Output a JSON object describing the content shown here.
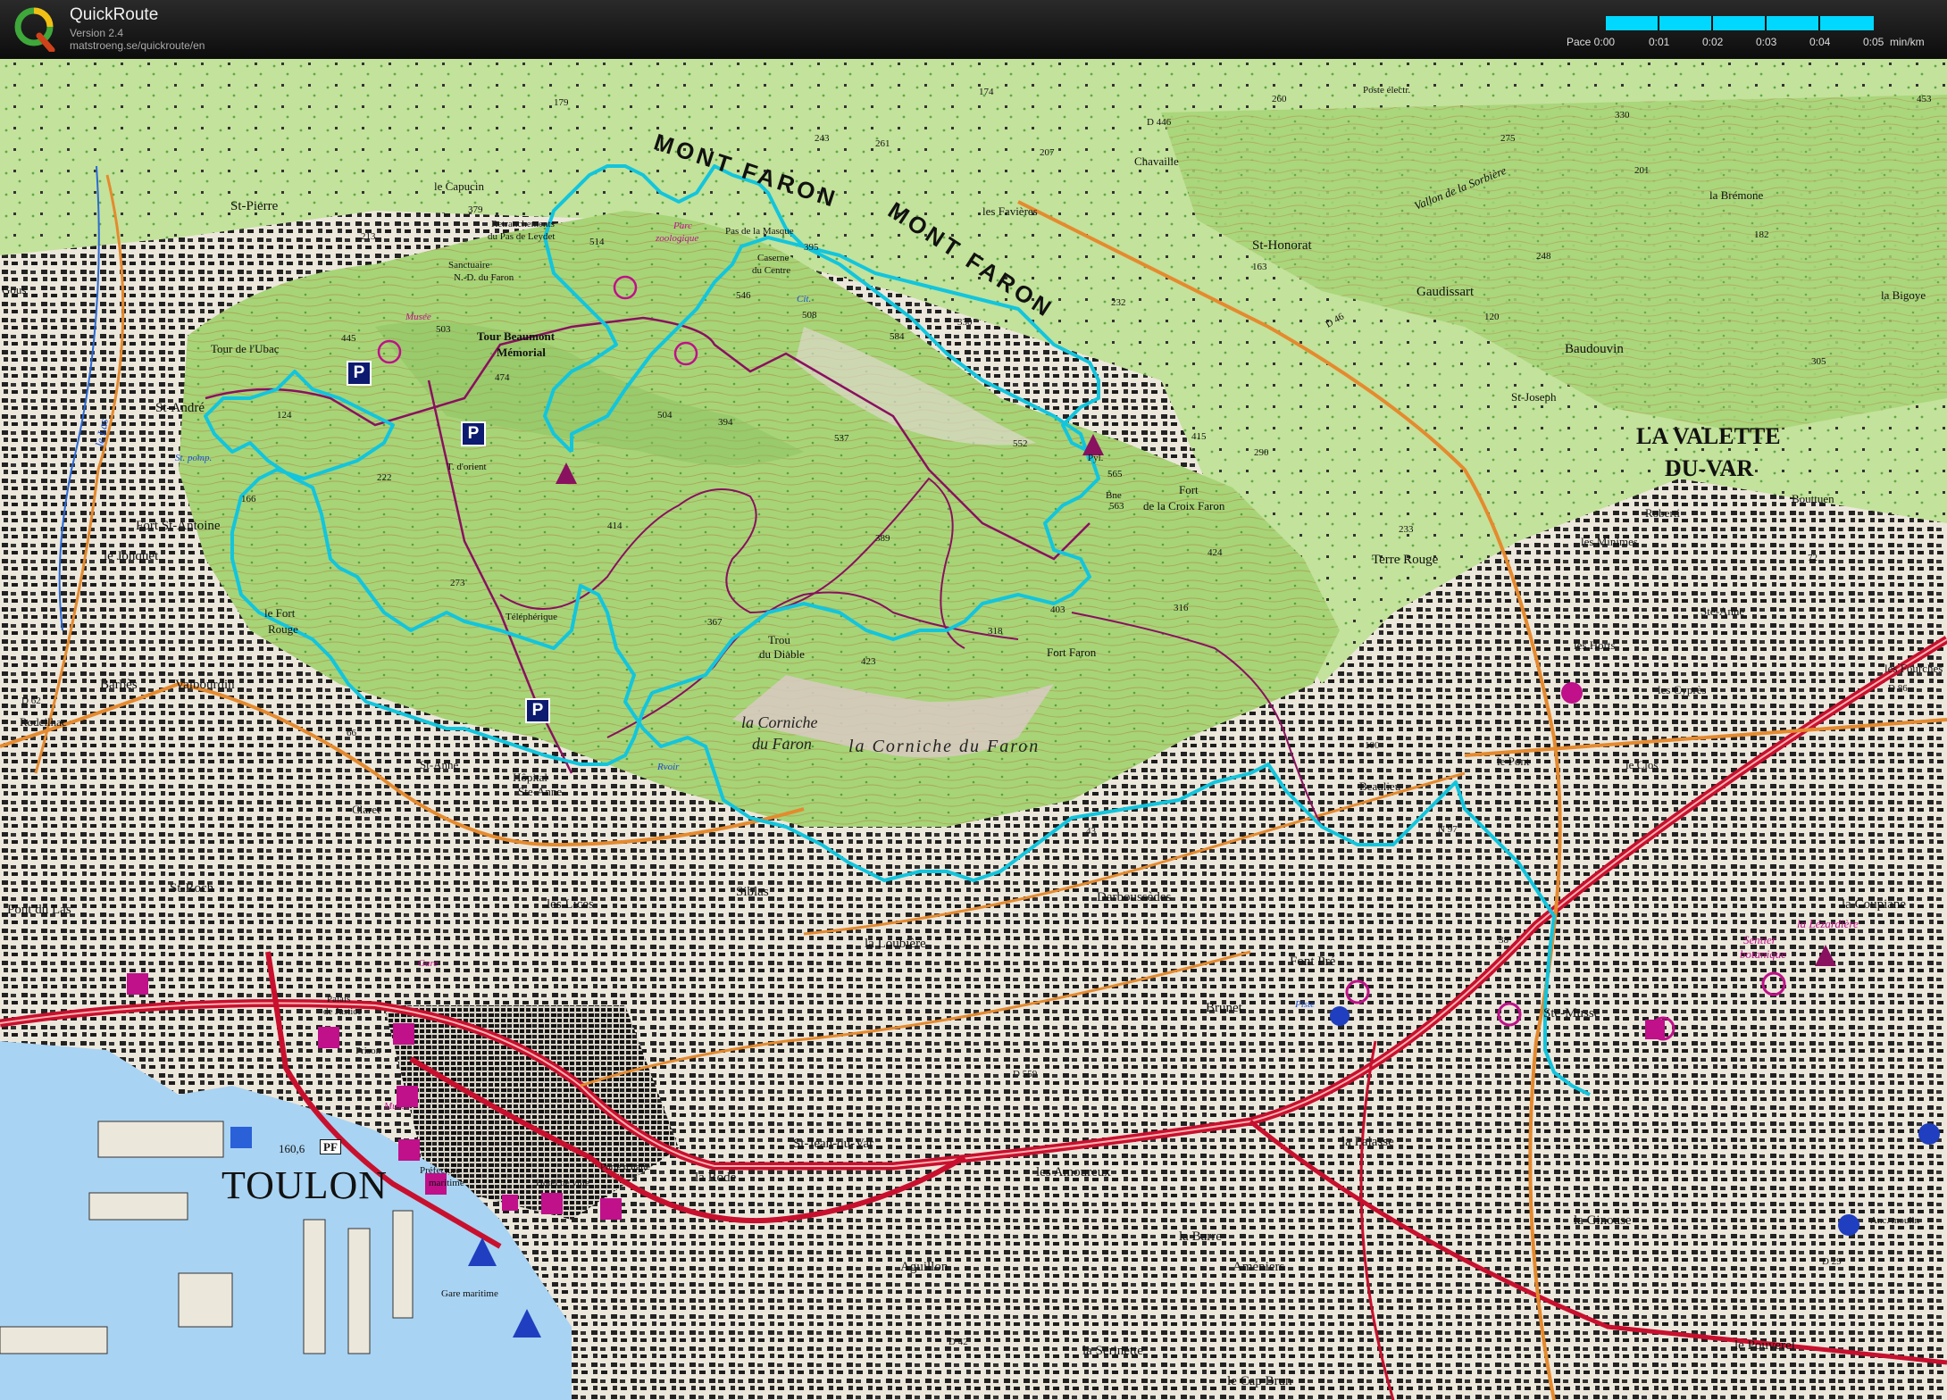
{
  "app": {
    "title": "QuickRoute",
    "version": "Version 2.4",
    "url": "matstroeng.se/quickroute/en"
  },
  "pace_scale": {
    "prefix": "Pace 0:00",
    "ticks": [
      "0:01",
      "0:02",
      "0:03",
      "0:04",
      "0:05"
    ],
    "unit": "min/km",
    "color": "#00d8ff"
  },
  "colors": {
    "route": "#12c5dd",
    "forest": "#9fd070",
    "trail": "#8a1060",
    "sea": "#a9d3f2",
    "urban": "#e7e1d5",
    "main_road": "#c8102e"
  },
  "map_labels": {
    "mont_faron_1": "MONT FARON",
    "mont_faron_2": "MONT FARON",
    "toulon": "TOULON",
    "la_valette": "LA VALETTE",
    "du_var": "DU-VAR",
    "corniche_1": "la Corniche",
    "corniche_2": "du Faron",
    "corniche_3": "la Corniche du Faron",
    "le_capucin": "le Capucin",
    "retranchements": "Retranchements",
    "pas_de_leydet": "du Pas de Leydet",
    "sanctuaire": "Sanctuaire",
    "nd_du_faron": "N.-D. du Faron",
    "parc": "Parc",
    "zoologique": "zoologique",
    "pas_de_la_masque": "Pas de la Masque",
    "caserne": "Caserne",
    "du_centre": "du Centre",
    "tour_beaumont": "Tour Beaumont",
    "memorial": "Mémorial",
    "tour_ubac": "Tour de l'Ubac",
    "musee_faron": "Musée",
    "st_pierre": "St-Pierre",
    "st_andre": "St-André",
    "fort_st_antoine": "Fort St-Antoine",
    "le_jonquet": "le Jonquet",
    "le_fort_rouge_1": "le Fort",
    "le_fort_rouge_2": "Rouge",
    "barbes": "Barbès",
    "valbourdin": "Valbourdin",
    "rodeilhac": "Rodeilhac",
    "claret": "Claret",
    "st_anne": "St-Anne",
    "hopital": "Hôpital",
    "ste_anne_h": "Ste-Anne",
    "st_roch": "St-Roch",
    "pont_du_las": "Pont du Las",
    "les_lices": "les Lices",
    "siblas": "Siblas",
    "la_loubiere": "la Loubière",
    "darboussedes": "Darboussèdes",
    "brunet": "Brunet",
    "font_pre": "Font Pré",
    "st_jean_du_var": "St-Jean-du-Var",
    "la_rode": "la Rode",
    "aguillon": "Aguillon",
    "les_amoureux": "les Amoureux",
    "la_barre": "la Barre",
    "ameniers": "Améniers",
    "la_serinette": "la Serinette",
    "le_cap_brun": "le Cap Brun",
    "la_palasse": "la Palasse",
    "la_ginouse": "la Ginouse",
    "le_pouverel": "le Pouverel",
    "ste_musse": "Ste-Musse",
    "la_coupiane": "la Coupiane",
    "la_lezardiere": "la Lézardière",
    "sentier_botanique_1": "Sentier",
    "sentier_botanique_2": "botanique",
    "beaulieu": "Beaulieu",
    "le_pont": "le Pont",
    "les_cypres": "les Cyprès",
    "les_horts": "les Horts",
    "ste_anne_v": "Ste-Anne",
    "les_minimes": "les Minimes",
    "roberti": "Roberti",
    "terre_rouge": "Terre Rouge",
    "fort_croix_faron_1": "Fort",
    "fort_croix_faron_2": "de la Croix Faron",
    "fort_faron": "Fort Faron",
    "trou_du_diable_1": "Trou",
    "trou_du_diable_2": "du Diable",
    "telepherique": "Téléphérique",
    "les_favieres": "les Favières",
    "chavaille": "Chavaille",
    "st_honorat": "St-Honorat",
    "gaudissart": "Gaudissart",
    "st_joseph": "St-Joseph",
    "baudouvin": "Baudouvin",
    "la_bremone": "la Brémone",
    "la_bigoye": "la Bigoye",
    "vallon_sorbiere": "Vallon de la Sorbière",
    "les_fourches": "les Fourches",
    "le_clos": "le Clos",
    "poste_electr": "Poste électr.",
    "gare_maritime": "Gare maritime",
    "prefecture_1": "Préfecture",
    "prefecture_2": "maritime",
    "hotel_de_ville": "Hôtel de ville",
    "porte_italie": "Porte d'Italie",
    "palais_1": "Palais",
    "palais_2": "de Justice",
    "prison": "Prison",
    "gare": "Gare",
    "musee_toulon": "Musée",
    "pf": "PF",
    "depth_160": "160,6",
    "le_las": "le Las",
    "gous": "Gous",
    "d62": "D 62",
    "d46": "D 46",
    "d446": "D 446",
    "d86": "D 86",
    "d29": "D 29",
    "n97": "N 97",
    "d559": "D 559",
    "d42": "D 42",
    "bouttuen": "Bouttuen",
    "t_dorient": "T. d'orient",
    "pyl": "Pyl.",
    "bne": "Bne",
    "cit": "Cit.",
    "st_pomp": "St. pomp.",
    "rvoir": "Rvoir",
    "piste": "Piste",
    "anc_moulin": "Anc. moulin",
    "alt_179": "179",
    "alt_243": "243",
    "alt_261": "261",
    "alt_174": "174",
    "alt_207": "207",
    "alt_260": "260",
    "alt_275": "275",
    "alt_330": "330",
    "alt_201": "201",
    "alt_248": "248",
    "alt_182": "182",
    "alt_379": "379",
    "alt_213": "213",
    "alt_514": "514",
    "alt_395": "395",
    "alt_546": "546",
    "alt_508": "508",
    "alt_503": "503",
    "alt_445": "445",
    "alt_474": "474",
    "alt_584": "584",
    "alt_330b": "330",
    "alt_232": "232",
    "alt_504": "504",
    "alt_394": "394",
    "alt_537": "537",
    "alt_552": "552",
    "alt_565": "565",
    "alt_563": "563",
    "alt_415": "415",
    "alt_290": "290",
    "alt_424": "424",
    "alt_233": "233",
    "alt_316": "316",
    "alt_403": "403",
    "alt_318": "318",
    "alt_389": "389",
    "alt_414": "414",
    "alt_367": "367",
    "alt_423": "423",
    "alt_273": "273",
    "alt_222": "222",
    "alt_124": "124",
    "alt_166": "166",
    "alt_100": "100",
    "alt_163": "163",
    "alt_120": "120",
    "alt_305": "305",
    "alt_453": "453",
    "alt_72": "72",
    "alt_38": "38",
    "alt_66": "66",
    "alt_43": "43"
  }
}
